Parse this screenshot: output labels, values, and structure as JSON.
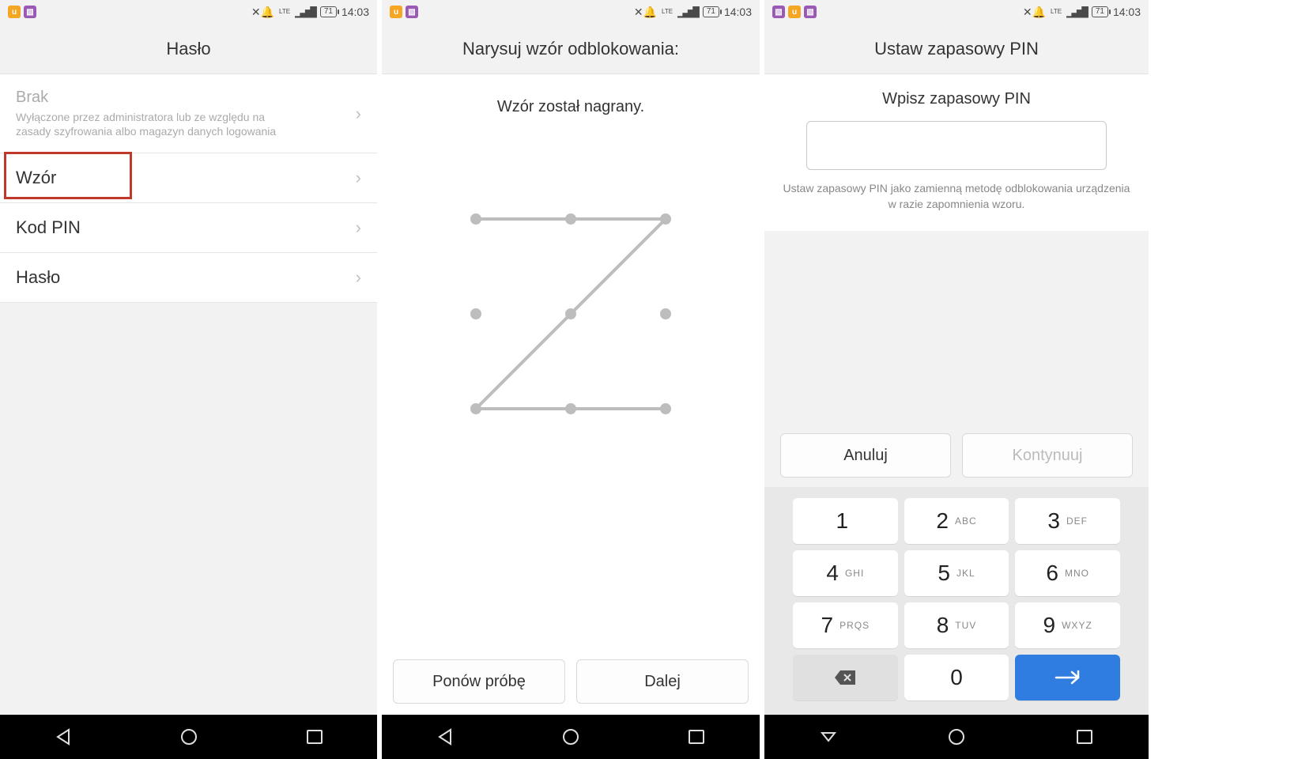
{
  "status": {
    "battery": "71",
    "time": "14:03",
    "net": "LTE"
  },
  "s1": {
    "header": "Hasło",
    "row0_title": "Brak",
    "row0_sub": "Wyłączone przez administratora lub ze względu na zasady szyfrowania albo magazyn danych logowania",
    "row1": "Wzór",
    "row2": "Kod PIN",
    "row3": "Hasło"
  },
  "s2": {
    "header": "Narysuj wzór odblokowania:",
    "prompt": "Wzór został nagrany.",
    "retry": "Ponów próbę",
    "next": "Dalej"
  },
  "s3": {
    "header": "Ustaw zapasowy PIN",
    "title": "Wpisz zapasowy PIN",
    "desc": "Ustaw zapasowy PIN jako zamienną metodę odblokowania urządzenia w razie zapomnienia wzoru.",
    "cancel": "Anuluj",
    "cont": "Kontynuuj",
    "keys": [
      {
        "n": "1",
        "l": ""
      },
      {
        "n": "2",
        "l": "ABC"
      },
      {
        "n": "3",
        "l": "DEF"
      },
      {
        "n": "4",
        "l": "GHI"
      },
      {
        "n": "5",
        "l": "JKL"
      },
      {
        "n": "6",
        "l": "MNO"
      },
      {
        "n": "7",
        "l": "PRQS"
      },
      {
        "n": "8",
        "l": "TUV"
      },
      {
        "n": "9",
        "l": "WXYZ"
      },
      {
        "n": "del",
        "l": ""
      },
      {
        "n": "0",
        "l": ""
      },
      {
        "n": "go",
        "l": ""
      }
    ]
  }
}
